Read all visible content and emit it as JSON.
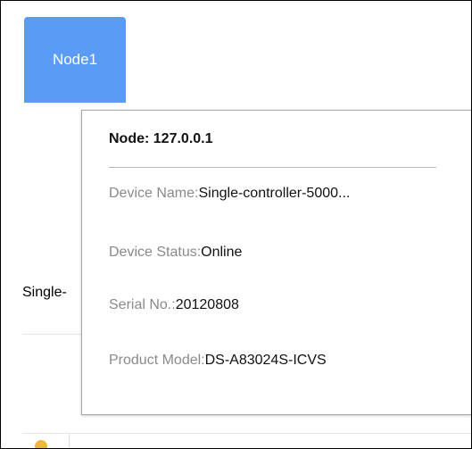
{
  "node_tile": {
    "label": "Node1",
    "color": "#5a9cf5"
  },
  "side_label": "Single-",
  "popup": {
    "title": "Node: 127.0.0.1",
    "rows": [
      {
        "label": "Device Name:",
        "value": "Single-controller-5000..."
      },
      {
        "label": "Device Status:",
        "value": "Online"
      },
      {
        "label": "Serial No.:",
        "value": "20120808"
      },
      {
        "label": "Product Model:",
        "value": "DS-A83024S-ICVS"
      }
    ]
  },
  "bottom_bar": {
    "status_dot_color": "#f0b63c"
  }
}
